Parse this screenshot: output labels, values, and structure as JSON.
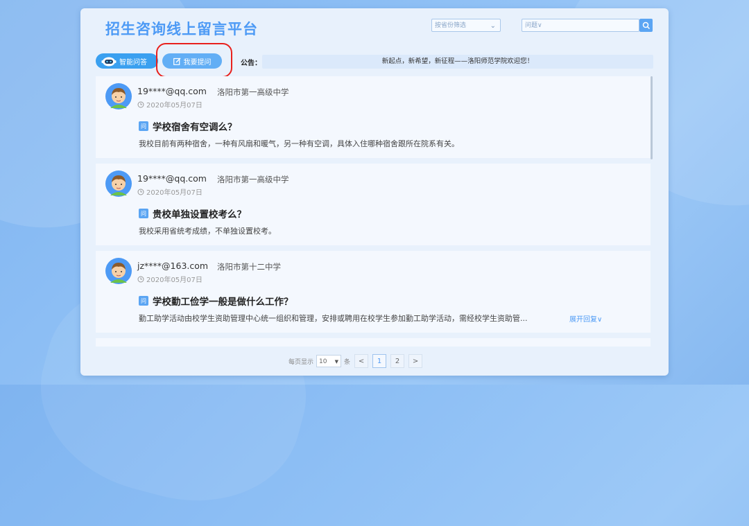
{
  "header": {
    "title": "招生咨询线上留言平台",
    "province_placeholder": "按省份筛选",
    "search_placeholder": "问题∨"
  },
  "toolbar": {
    "ai_label": "智能问答",
    "ask_label": "我要提问",
    "notice_label": "公告：",
    "notice_text": "新起点，新希望，新征程——洛阳师范学院欢迎您！"
  },
  "questions": [
    {
      "email": "19****@qq.com",
      "school": "洛阳市第一高级中学",
      "date": "2020年05月07日",
      "badge": "问",
      "question": "学校宿舍有空调么？",
      "answer": "我校目前有两种宿舍，一种有风扇和暖气，另一种有空调，具体入住哪种宿舍跟所在院系有关。"
    },
    {
      "email": "19****@qq.com",
      "school": "洛阳市第一高级中学",
      "date": "2020年05月07日",
      "badge": "问",
      "question": "贵校单独设置校考么？",
      "answer": "我校采用省统考成绩，不单独设置校考。"
    },
    {
      "email": "jz****@163.com",
      "school": "洛阳市第十二中学",
      "date": "2020年05月07日",
      "badge": "问",
      "question": "学校勤工俭学一般是做什么工作？",
      "answer": "勤工助学活动由校学生资助管理中心统一组织和管理，安排或聘用在校学生参加勤工助学活动，需经校学生资助管...",
      "expand_label": "展开回复∨"
    }
  ],
  "pagination": {
    "per_page_label": "每页显示",
    "per_page_value": "10",
    "unit_label": "条",
    "prev": "<",
    "pages": [
      "1",
      "2"
    ],
    "next": ">"
  },
  "colors": {
    "accent": "#4d9af5",
    "highlight_ring": "#e8201c"
  }
}
